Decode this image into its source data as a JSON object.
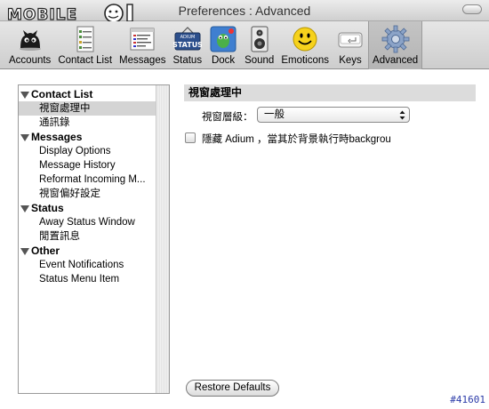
{
  "window": {
    "title": "Preferences : Advanced",
    "watermark_logo_text": "MOBILE01"
  },
  "toolbar": {
    "items": [
      {
        "label": "Accounts",
        "icon": "accounts-icon"
      },
      {
        "label": "Contact List",
        "icon": "contact-list-icon"
      },
      {
        "label": "Messages",
        "icon": "messages-icon"
      },
      {
        "label": "Status",
        "icon": "status-icon"
      },
      {
        "label": "Dock",
        "icon": "dock-icon"
      },
      {
        "label": "Sound",
        "icon": "sound-icon"
      },
      {
        "label": "Emoticons",
        "icon": "emoticons-icon"
      },
      {
        "label": "Keys",
        "icon": "keys-icon"
      },
      {
        "label": "Advanced",
        "icon": "advanced-icon",
        "selected": true
      }
    ],
    "status_icon_text": "ADIUM STATUS"
  },
  "sidebar": {
    "groups": [
      {
        "label": "Contact List",
        "items": [
          "視窗處理中",
          "通訊錄"
        ]
      },
      {
        "label": "Messages",
        "items": [
          "Display Options",
          "Message History",
          "Reformat Incoming M...",
          "視窗偏好設定"
        ]
      },
      {
        "label": "Status",
        "items": [
          "Away Status Window",
          "閒置訊息"
        ]
      },
      {
        "label": "Other",
        "items": [
          "Event Notifications",
          "Status Menu Item"
        ]
      }
    ],
    "selected": "視窗處理中"
  },
  "panel": {
    "header": "視窗處理中",
    "level_label": "視窗層級：",
    "level_value": "一般",
    "hide_checkbox_label": "隱藏 Adium ，當其於背景執行時backgrou",
    "hide_checked": false
  },
  "footer": {
    "restore_label": "Restore Defaults",
    "watermark_id": "#41601"
  },
  "colors": {
    "selected_row": "#d4d4d4",
    "panel_header": "#dcdcdc",
    "watermark_id": "#2a3aa8"
  }
}
